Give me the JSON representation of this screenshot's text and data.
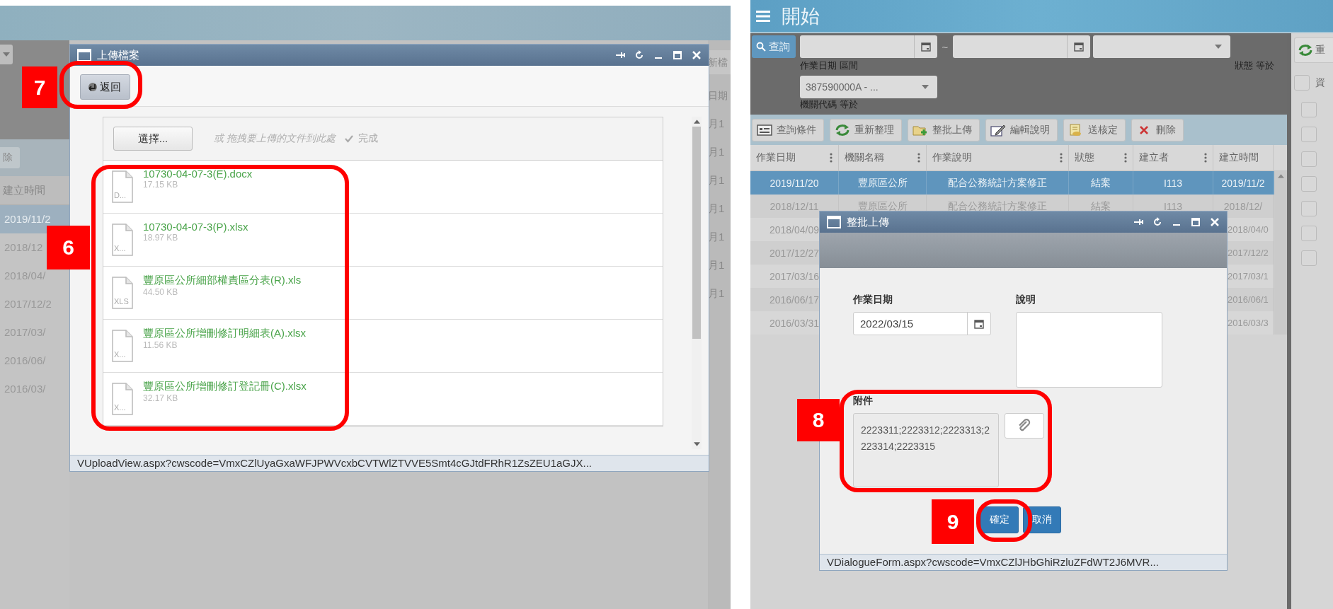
{
  "left_screen": {
    "background": {
      "left_column": {
        "button": "除",
        "header": "建立時間",
        "rows": [
          {
            "text": "2019/11/2",
            "selected": true
          },
          {
            "text": "2018/12",
            "selected": false
          },
          {
            "text": "2018/04/",
            "selected": false
          },
          {
            "text": "2017/12/2",
            "selected": false
          },
          {
            "text": "2017/03/",
            "selected": false
          },
          {
            "text": "2016/06/",
            "selected": false
          },
          {
            "text": "2016/03/",
            "selected": false
          }
        ]
      },
      "right_column": {
        "button": "新檔",
        "header": "日期",
        "rows": [
          "月1",
          "月1",
          "月1",
          "月1",
          "月1",
          "月1",
          "月1"
        ]
      }
    },
    "dialog": {
      "title": "上傳檔案",
      "back_button": "返回",
      "choose_button": "選擇...",
      "drop_hint": "或 拖拽要上傳的文件到此處",
      "done": "完成",
      "files": [
        {
          "badge": "D...",
          "name": "10730-04-07-3(E).docx",
          "size": "17.15 KB"
        },
        {
          "badge": "X...",
          "name": "10730-04-07-3(P).xlsx",
          "size": "18.97 KB"
        },
        {
          "badge": "XLS",
          "name": "豐原區公所細部權責區分表(R).xls",
          "size": "44.50 KB"
        },
        {
          "badge": "X...",
          "name": "豐原區公所增刪修訂明細表(A).xlsx",
          "size": "11.56 KB"
        },
        {
          "badge": "X...",
          "name": "豐原區公所增刪修訂登記冊(C).xlsx",
          "size": "32.17 KB"
        }
      ],
      "status_bar": "VUploadView.aspx?cwscode=VmxCZlUyaGxaWFJPWVcxbCVTWlZTVVE5Smt4cGJtdFRhR1ZsZEU1aGJX...",
      "callouts": [
        {
          "number": "7",
          "kind": "back"
        },
        {
          "number": "6",
          "kind": "files"
        }
      ]
    }
  },
  "right_screen": {
    "header": {
      "title": "開始"
    },
    "filters": {
      "search_button": "查詢",
      "range_separator": "~",
      "date_range_label": "作業日期 區間",
      "status_label": "狀態 等於",
      "agency_value": "387590000A - ...",
      "agency_label": "機關代碼 等於"
    },
    "toolbar": [
      {
        "kind": "filter",
        "label": "查詢條件"
      },
      {
        "kind": "refresh",
        "label": "重新整理"
      },
      {
        "kind": "upload",
        "label": "整批上傳"
      },
      {
        "kind": "edit",
        "label": "編輯說明"
      },
      {
        "kind": "approve",
        "label": "送核定"
      },
      {
        "kind": "delete",
        "label": "刪除"
      }
    ],
    "table": {
      "columns": [
        "作業日期",
        "機關名稱",
        "作業說明",
        "狀態",
        "建立者",
        "建立時間"
      ],
      "rows": [
        {
          "selected": true,
          "cells": [
            "2019/11/20",
            "豐原區公所",
            "配合公務統計方案修正",
            "結案",
            "I113",
            "2019/11/2"
          ]
        },
        {
          "selected": false,
          "cells": [
            "2018/12/11",
            "豐原區公所",
            "配合公務統計方案修正",
            "結案",
            "I113",
            "2018/12/"
          ]
        },
        {
          "selected": false,
          "cells": [
            "2018/04/09",
            "2018/04/0"
          ]
        },
        {
          "selected": false,
          "cells": [
            "2017/12/27",
            "2017/12/2"
          ]
        },
        {
          "selected": false,
          "cells": [
            "2017/03/16",
            "2017/03/1"
          ]
        },
        {
          "selected": false,
          "cells": [
            "2016/06/17",
            "2016/06/1"
          ]
        },
        {
          "selected": false,
          "cells": [
            "2016/03/31",
            "2016/03/3"
          ]
        }
      ]
    },
    "side_panel": {
      "button": "重",
      "header": "資",
      "checkboxes": [
        {
          "checked": false
        },
        {
          "checked": false
        },
        {
          "checked": false
        },
        {
          "checked": false
        },
        {
          "checked": false
        },
        {
          "checked": false
        },
        {
          "checked": false
        },
        {
          "checked": false
        }
      ]
    },
    "dialog": {
      "title": "整批上傳",
      "date_label": "作業日期",
      "date_value": "2022/03/15",
      "note_label": "說明",
      "attachment_label": "附件",
      "attachment_value": "2223311;2223312;2223313;2223314;2223315",
      "ok_button": "確定",
      "cancel_button": "取消",
      "status_bar": "VDialogueForm.aspx?cwscode=VmxCZlJHbGhiRzluZFdWT2J6MVR...",
      "callouts": [
        {
          "number": "8",
          "kind": "attachment"
        },
        {
          "number": "9",
          "kind": "ok"
        }
      ]
    }
  }
}
